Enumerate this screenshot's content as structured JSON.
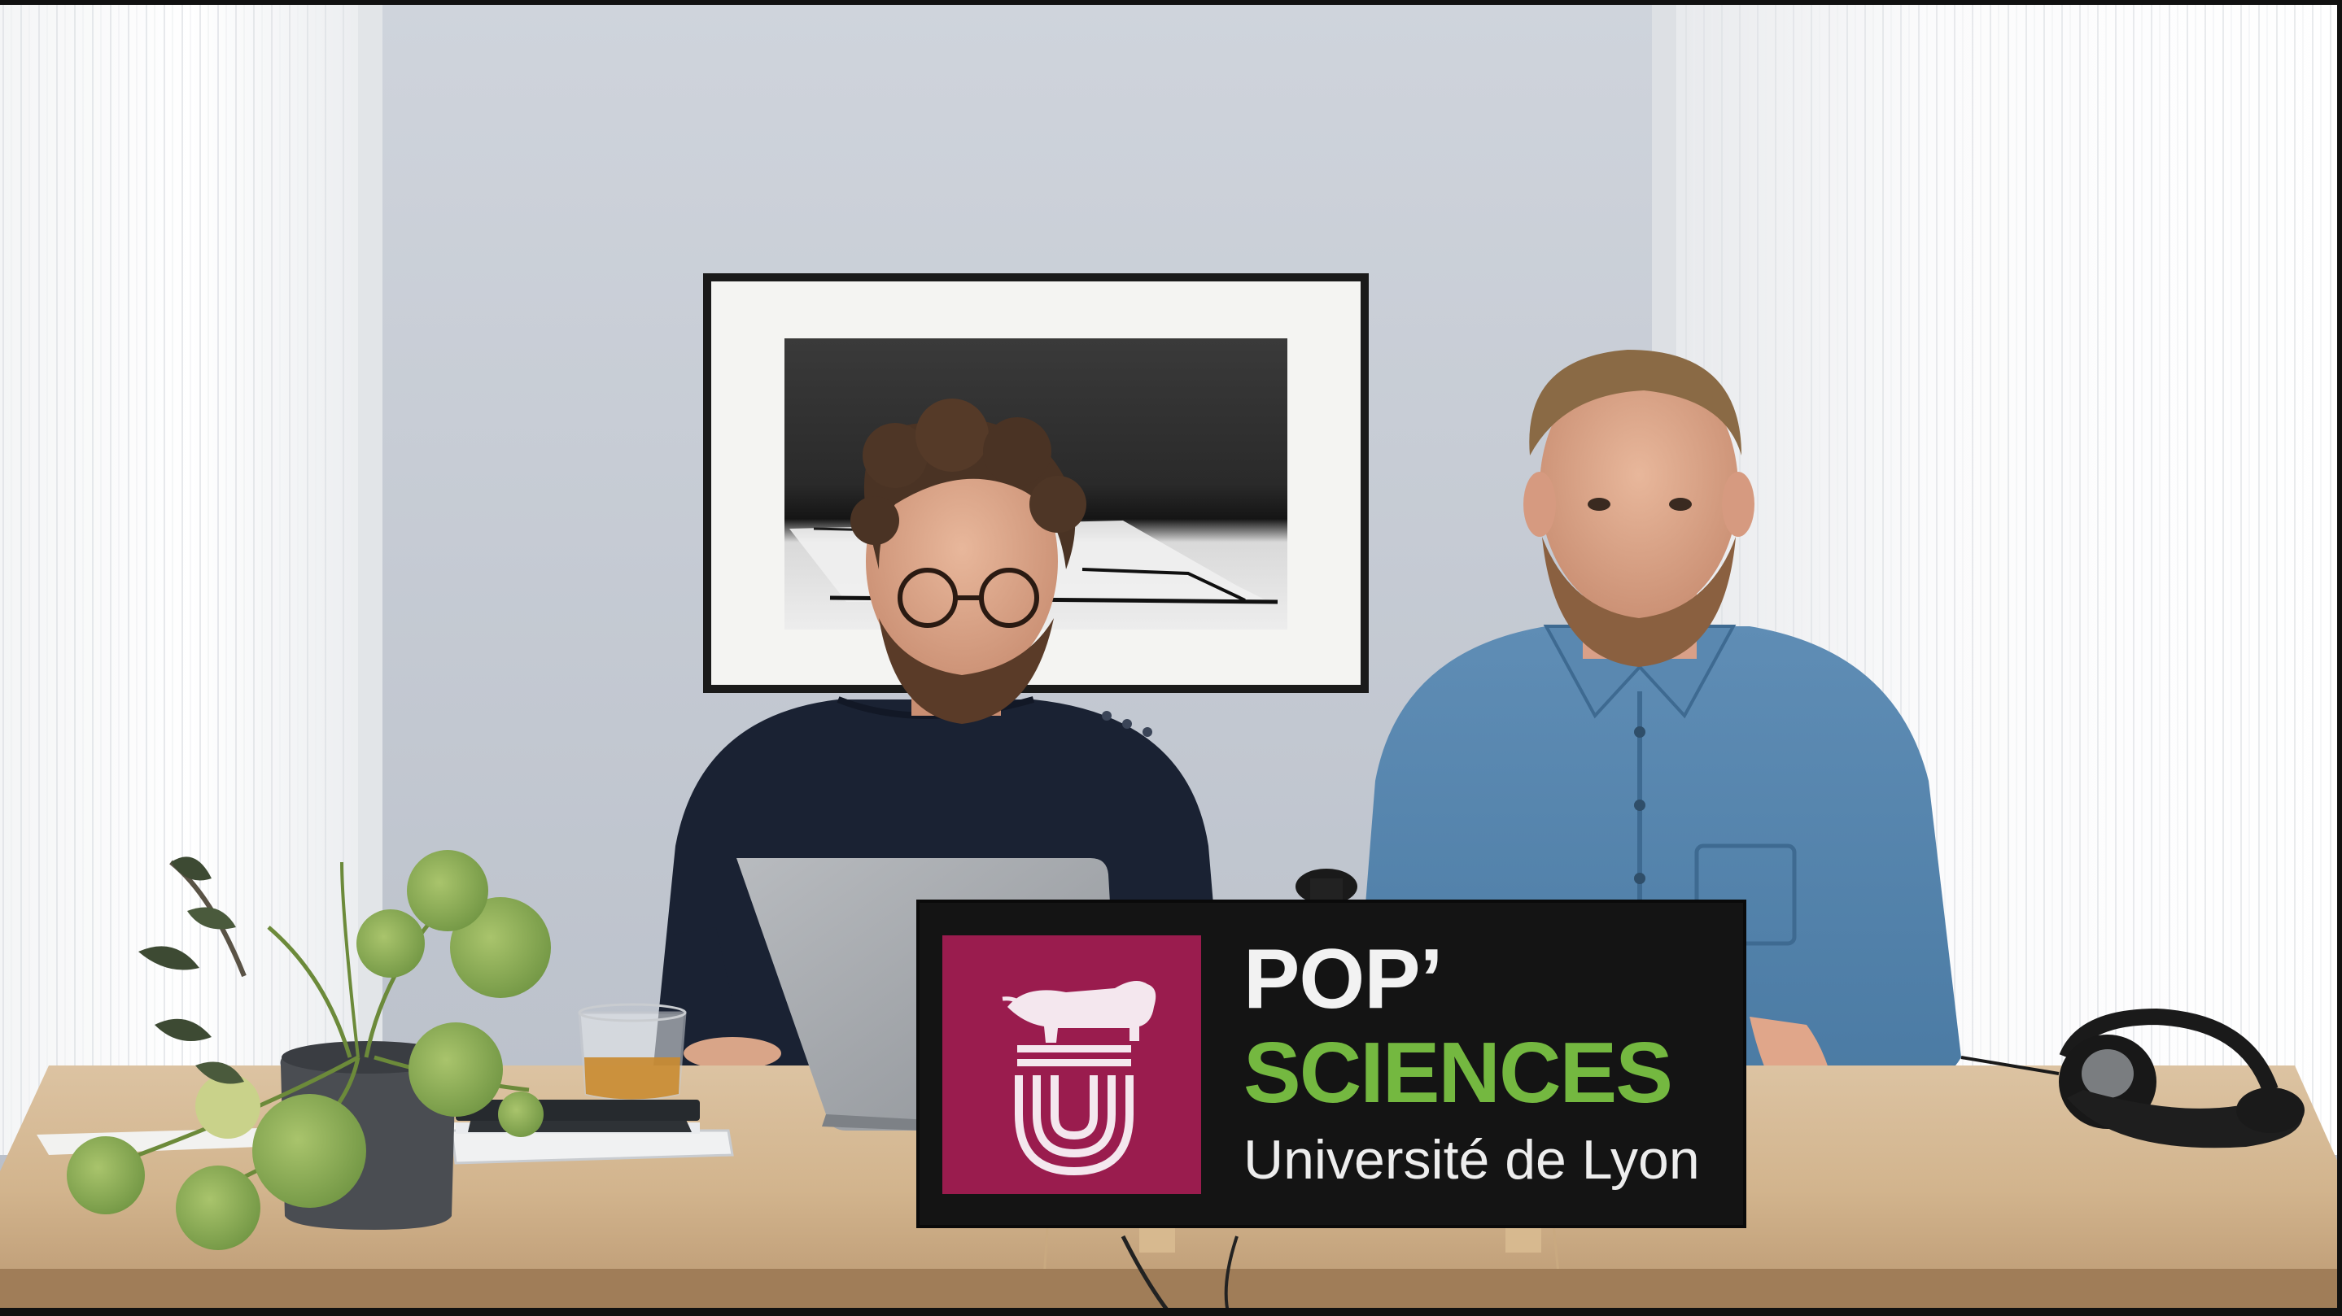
{
  "sign": {
    "line1": "POP’",
    "line2": "SCIENCES",
    "line3": "Université de Lyon",
    "logo": "lion-university-logo-icon",
    "colors": {
      "panel": "#141414",
      "logo_background": "#9a1c4e",
      "sciences_green": "#74b840",
      "text_white": "#f2f2f2"
    }
  }
}
